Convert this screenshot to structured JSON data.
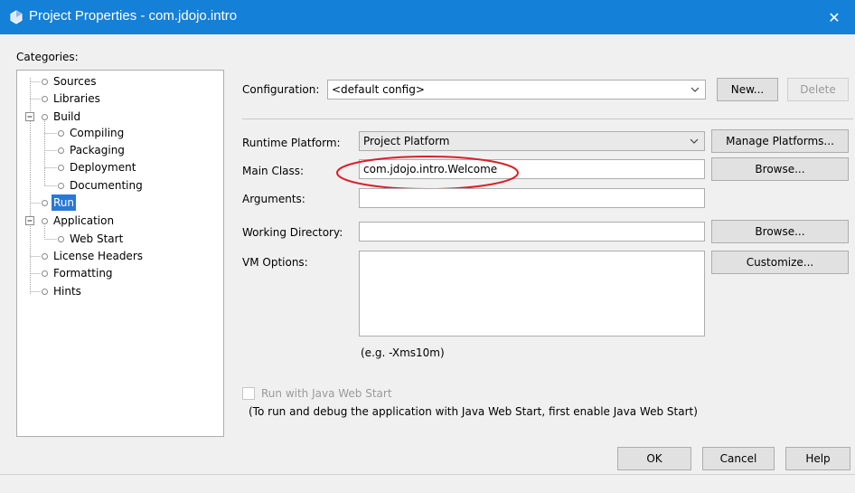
{
  "window": {
    "title": "Project Properties - com.jdojo.intro",
    "icon": "project-icon",
    "close_glyph": "✕"
  },
  "categories": {
    "label": "Categories:",
    "items": [
      {
        "label": "Sources",
        "level": 1,
        "expander": false
      },
      {
        "label": "Libraries",
        "level": 1,
        "expander": false
      },
      {
        "label": "Build",
        "level": 1,
        "expander": "expanded"
      },
      {
        "label": "Compiling",
        "level": 2,
        "expander": false
      },
      {
        "label": "Packaging",
        "level": 2,
        "expander": false
      },
      {
        "label": "Deployment",
        "level": 2,
        "expander": false
      },
      {
        "label": "Documenting",
        "level": 2,
        "expander": false
      },
      {
        "label": "Run",
        "level": 1,
        "expander": false,
        "selected": true
      },
      {
        "label": "Application",
        "level": 1,
        "expander": "expanded"
      },
      {
        "label": "Web Start",
        "level": 2,
        "expander": false
      },
      {
        "label": "License Headers",
        "level": 1,
        "expander": false
      },
      {
        "label": "Formatting",
        "level": 1,
        "expander": false
      },
      {
        "label": "Hints",
        "level": 1,
        "expander": false
      }
    ]
  },
  "configuration": {
    "label": "Configuration:",
    "value": "<default config>",
    "new_label": "New...",
    "delete_label": "Delete"
  },
  "runtime_platform": {
    "label": "Runtime Platform:",
    "value": "Project Platform",
    "manage_label": "Manage Platforms..."
  },
  "main_class": {
    "label": "Main Class:",
    "value": "com.jdojo.intro.Welcome",
    "browse_label": "Browse..."
  },
  "arguments": {
    "label": "Arguments:",
    "value": ""
  },
  "working_directory": {
    "label": "Working Directory:",
    "value": "",
    "browse_label": "Browse..."
  },
  "vm_options": {
    "label": "VM Options:",
    "value": "",
    "customize_label": "Customize...",
    "hint": "(e.g. -Xms10m)"
  },
  "web_start": {
    "checkbox_label": "Run with Java Web Start",
    "checked": false,
    "note": "(To run and debug the application with Java Web Start, first enable Java Web Start)"
  },
  "footer": {
    "ok_label": "OK",
    "cancel_label": "Cancel",
    "help_label": "Help"
  },
  "colors": {
    "titlebar": "#1580d8",
    "selection": "#2a78d6",
    "annotation": "#d9202a"
  }
}
